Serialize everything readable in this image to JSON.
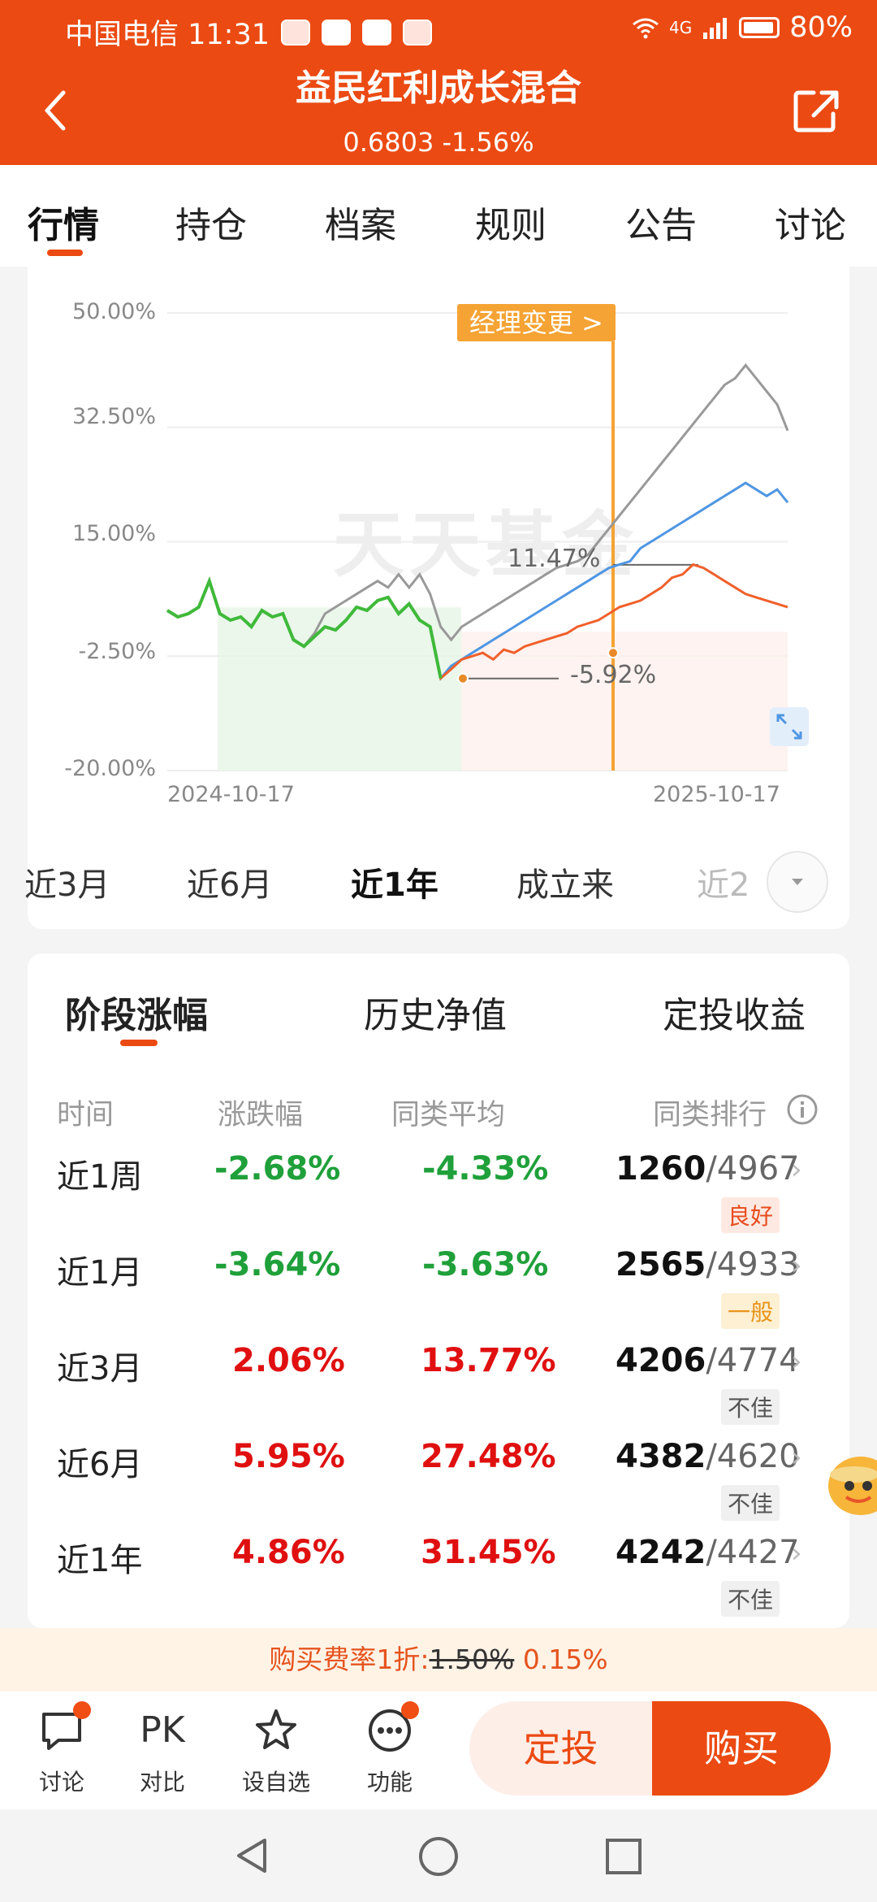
{
  "status_bar": {
    "carrier_time": "中国电信 11:31",
    "battery": "80%",
    "network": "4G"
  },
  "header": {
    "title": "益民红利成长混合",
    "nav_change": "0.6803 -1.56%"
  },
  "tabs": [
    "行情",
    "持仓",
    "档案",
    "规则",
    "公告",
    "讨论"
  ],
  "chart": {
    "y_ticks": [
      "50.00%",
      "32.50%",
      "15.00%",
      "-2.50%",
      "-20.00%"
    ],
    "x_start": "2024-10-17",
    "x_end": "2025-10-17",
    "watermark": "天天基金",
    "manager_change": "经理变更 >",
    "annotation_high": "11.47%",
    "annotation_low": "-5.92%"
  },
  "chart_data": {
    "type": "line",
    "x": [
      "2024-10-17",
      "2025-10-17"
    ],
    "ylim": [
      -20,
      50
    ],
    "y_ticks": [
      50,
      32.5,
      15,
      -2.5,
      -20
    ],
    "series": [
      {
        "color": "#f0602a",
        "values": [
          4.5,
          3.5,
          4,
          5,
          9,
          4,
          3,
          3.5,
          2,
          4.5,
          3.5,
          4,
          0,
          -1,
          0.5,
          2,
          1.5,
          3,
          5,
          4.5,
          6,
          6.5,
          4,
          5.5,
          3,
          2,
          -5.9,
          -4.5,
          -3,
          -2.5,
          -2,
          -3,
          -1.5,
          -2,
          -1,
          -0.5,
          0,
          0.5,
          1,
          2,
          2.5,
          3,
          4,
          5,
          5.5,
          6,
          7,
          8,
          9.5,
          10,
          11.5,
          11,
          10,
          9,
          8,
          7,
          6.5,
          6,
          5.5,
          5
        ]
      },
      {
        "color": "#4f96e3",
        "values": [
          4.5,
          3.5,
          4,
          5,
          9,
          4,
          3,
          3.5,
          2,
          4.5,
          3.5,
          4,
          0,
          -1,
          0.5,
          2,
          1.5,
          3,
          5,
          4.5,
          6,
          6.5,
          4,
          5.5,
          3,
          2,
          -5.9,
          -4,
          -3,
          -2,
          -1,
          0,
          1,
          2,
          3,
          4,
          5,
          6,
          7,
          8,
          9,
          10,
          11,
          11.5,
          12,
          14,
          15,
          16,
          17,
          18,
          19,
          20,
          21,
          22,
          23,
          24,
          23,
          22,
          23,
          21
        ]
      },
      {
        "color": "#999999",
        "values": [
          4.5,
          3.5,
          4,
          5,
          9,
          4,
          3,
          3.5,
          2,
          4.5,
          3.5,
          4,
          0,
          -1,
          1,
          4,
          5,
          6,
          7,
          8,
          9,
          8,
          10,
          8,
          10,
          7,
          2,
          0,
          2,
          3,
          4,
          5,
          6,
          7,
          8,
          9,
          10,
          11,
          11.5,
          12,
          13,
          15,
          17,
          19,
          21,
          23,
          25,
          27,
          29,
          31,
          33,
          35,
          37,
          39,
          40,
          42,
          40,
          38,
          36,
          32
        ]
      }
    ],
    "annotations": [
      "11.47%",
      "-5.92%"
    ]
  },
  "periods": [
    "近3月",
    "近6月",
    "近1年",
    "成立来",
    "近2"
  ],
  "active_period": "近1年",
  "perf": {
    "tabs": [
      "阶段涨幅",
      "历史净值",
      "定投收益"
    ],
    "headers": [
      "时间",
      "涨跌幅",
      "同类平均",
      "同类排行"
    ],
    "rows": [
      {
        "period": "近1周",
        "change": "-2.68%",
        "avg": "-4.33%",
        "rank": "1260",
        "total": "/4967",
        "level": "良好"
      },
      {
        "period": "近1月",
        "change": "-3.64%",
        "avg": "-3.63%",
        "rank": "2565",
        "total": "/4933",
        "level": "一般"
      },
      {
        "period": "近3月",
        "change": "2.06%",
        "avg": "13.77%",
        "rank": "4206",
        "total": "/4774",
        "level": "不佳"
      },
      {
        "period": "近6月",
        "change": "5.95%",
        "avg": "27.48%",
        "rank": "4382",
        "total": "/4620",
        "level": "不佳"
      },
      {
        "period": "近1年",
        "change": "4.86%",
        "avg": "31.45%",
        "rank": "4242",
        "total": "/4427",
        "level": "不佳"
      }
    ]
  },
  "fee": {
    "prefix": "购买费率1折:",
    "old": "1.50%",
    "new": "0.15%"
  },
  "bottom": {
    "items": [
      {
        "label": "讨论",
        "icon": "chat-icon"
      },
      {
        "label": "对比",
        "icon": "pk-icon",
        "text": "PK"
      },
      {
        "label": "设自选",
        "icon": "star-icon"
      },
      {
        "label": "功能",
        "icon": "more-icon"
      }
    ],
    "sip_button": "定投",
    "buy_button": "购买"
  }
}
